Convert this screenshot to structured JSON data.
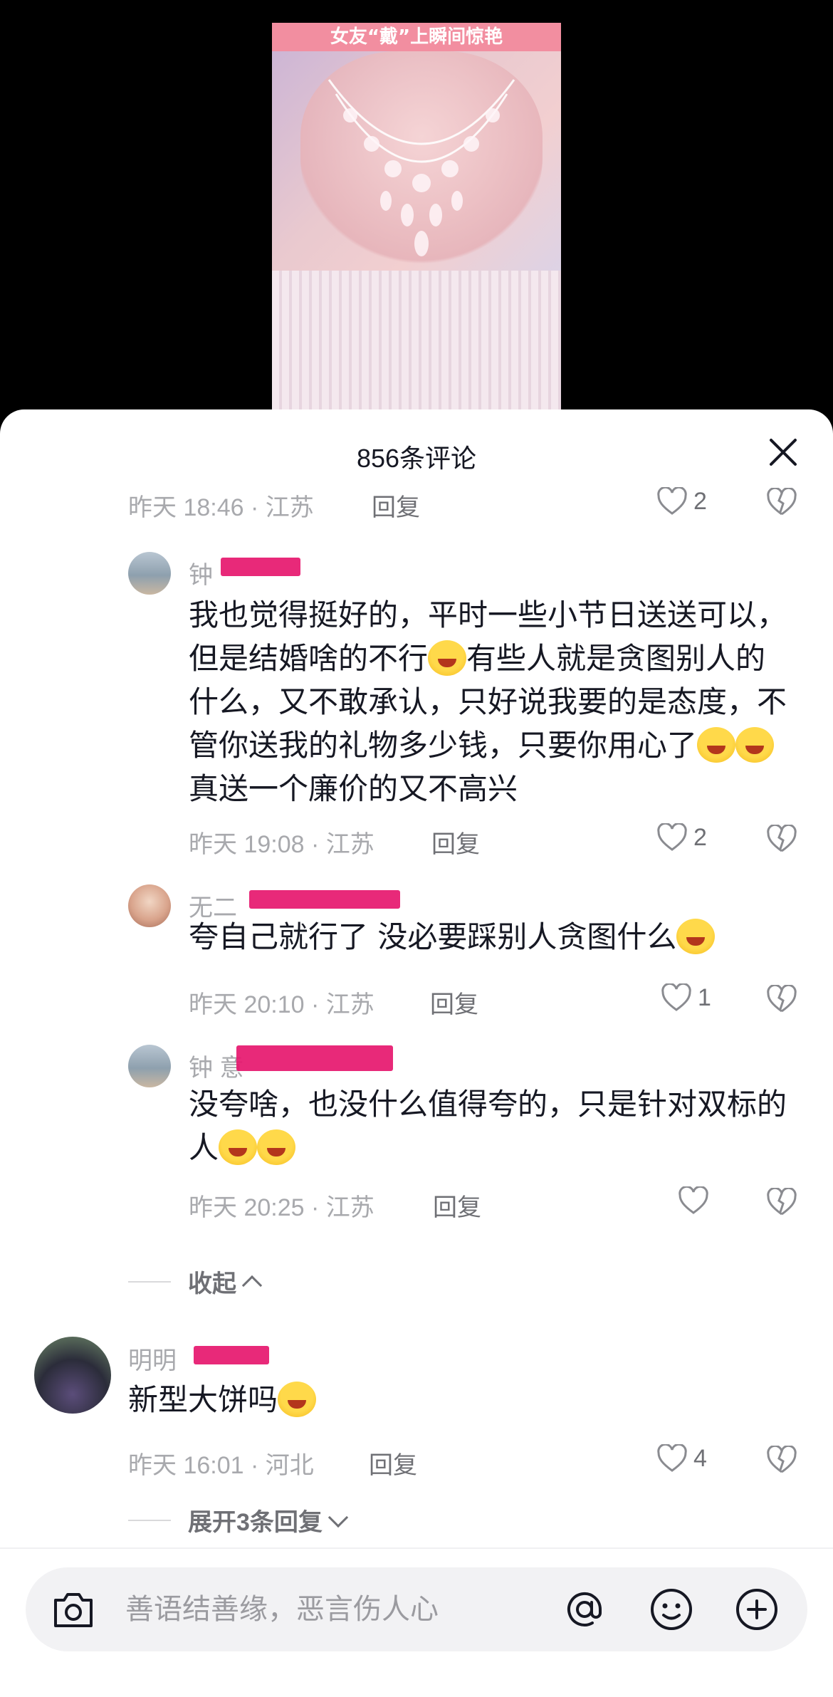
{
  "video": {
    "banner": "女友“戴”上瞬间惊艳"
  },
  "sheet": {
    "title": "856条评论"
  },
  "top_meta": {
    "time_location": "昨天 18:46 · 江苏",
    "reply": "回复",
    "likes": "2"
  },
  "comments": [
    {
      "name": "钟",
      "text": "我也觉得挺好的，平时一些小节日送送可以，但是结婚啥的不行",
      "text2": "有些人就是贪图别人的什么，又不敢承认，只好说我要的是态度，不管你送我的礼物多少钱，只要你用心了",
      "text3": "真送一个廉价的又不高兴",
      "time_location": "昨天 19:08 · 江苏",
      "reply": "回复",
      "likes": "2"
    },
    {
      "name": "无二",
      "text": "夸自己就行了 没必要踩别人贪图什么",
      "time_location": "昨天 20:10 · 江苏",
      "reply": "回复",
      "likes": "1"
    },
    {
      "name": "钟 意",
      "text": "没夸啥，也没什么值得夸的，只是针对双标的人",
      "time_location": "昨天 20:25 · 江苏",
      "reply": "回复",
      "likes": ""
    },
    {
      "name": "明明",
      "text": "新型大饼吗",
      "time_location": "昨天 16:01 · 河北",
      "reply": "回复",
      "likes": "4"
    }
  ],
  "collapse_label": "收起",
  "expand_label": "展开3条回复",
  "input": {
    "placeholder": "善语结善缘，恶言伤人心"
  },
  "icons": {
    "camera": "camera-icon",
    "at": "at-icon",
    "emoji": "emoji-icon",
    "plus": "plus-icon",
    "close": "close-icon",
    "heart": "heart-icon",
    "broken_heart": "broken-heart-icon"
  },
  "colors": {
    "redaction": "#e6176e",
    "text": "#161823",
    "meta": "#a8a9ad"
  }
}
